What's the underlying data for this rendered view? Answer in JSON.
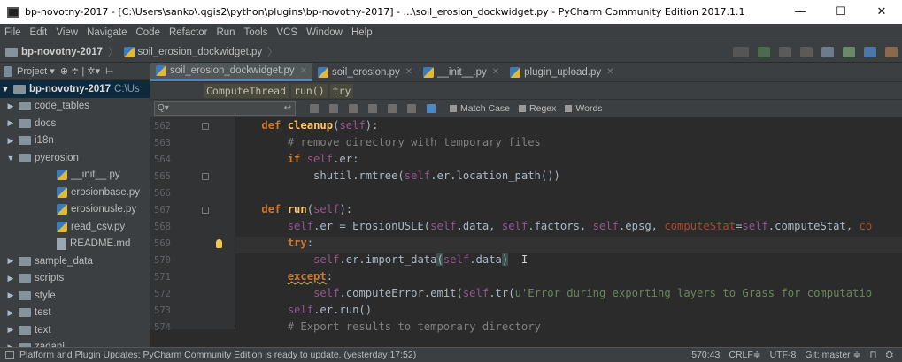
{
  "window": {
    "title": "bp-novotny-2017 - [C:\\Users\\sanko\\.qgis2\\python\\plugins\\bp-novotny-2017] - ...\\soil_erosion_dockwidget.py - PyCharm Community Edition 2017.1.1",
    "minimize": "—",
    "maximize": "☐",
    "close": "✕"
  },
  "menu": [
    "File",
    "Edit",
    "View",
    "Navigate",
    "Code",
    "Refactor",
    "Run",
    "Tools",
    "VCS",
    "Window",
    "Help"
  ],
  "nav": {
    "project": "bp-novotny-2017",
    "file": "soil_erosion_dockwidget.py"
  },
  "project_panel": {
    "header": "Project ▾",
    "root": "bp-novotny-2017",
    "root_path": "C:\\Us",
    "items": [
      {
        "label": "code_tables",
        "type": "folder"
      },
      {
        "label": "docs",
        "type": "folder"
      },
      {
        "label": "i18n",
        "type": "folder"
      },
      {
        "label": "pyerosion",
        "type": "folder-open"
      },
      {
        "label": "__init__.py",
        "type": "py"
      },
      {
        "label": "erosionbase.py",
        "type": "py"
      },
      {
        "label": "erosionusle.py",
        "type": "py"
      },
      {
        "label": "read_csv.py",
        "type": "py"
      },
      {
        "label": "README.md",
        "type": "md"
      },
      {
        "label": "sample_data",
        "type": "folder"
      },
      {
        "label": "scripts",
        "type": "folder"
      },
      {
        "label": "style",
        "type": "folder"
      },
      {
        "label": "test",
        "type": "folder"
      },
      {
        "label": "text",
        "type": "folder"
      },
      {
        "label": "zadani",
        "type": "folder"
      }
    ]
  },
  "tabs": [
    {
      "label": "soil_erosion_dockwidget.py",
      "active": true
    },
    {
      "label": "soil_erosion.py",
      "active": false
    },
    {
      "label": "__init__.py",
      "active": false
    },
    {
      "label": "plugin_upload.py",
      "active": false
    }
  ],
  "breadcrumbs": [
    "ComputeThread",
    "run()",
    "try"
  ],
  "find": {
    "placeholder": "Q▾",
    "match_case": "Match Case",
    "regex": "Regex",
    "words": "Words"
  },
  "code": {
    "line_numbers": [
      "562",
      "563",
      "564",
      "565",
      "566",
      "567",
      "568",
      "569",
      "570",
      "571",
      "572",
      "573",
      "574"
    ]
  },
  "status": {
    "message": "Platform and Plugin Updates: PyCharm Community Edition is ready to update. (yesterday 17:52)",
    "position": "570:43",
    "line_sep": "CRLF≑",
    "encoding": "UTF-8",
    "git": "Git: master ≑"
  }
}
